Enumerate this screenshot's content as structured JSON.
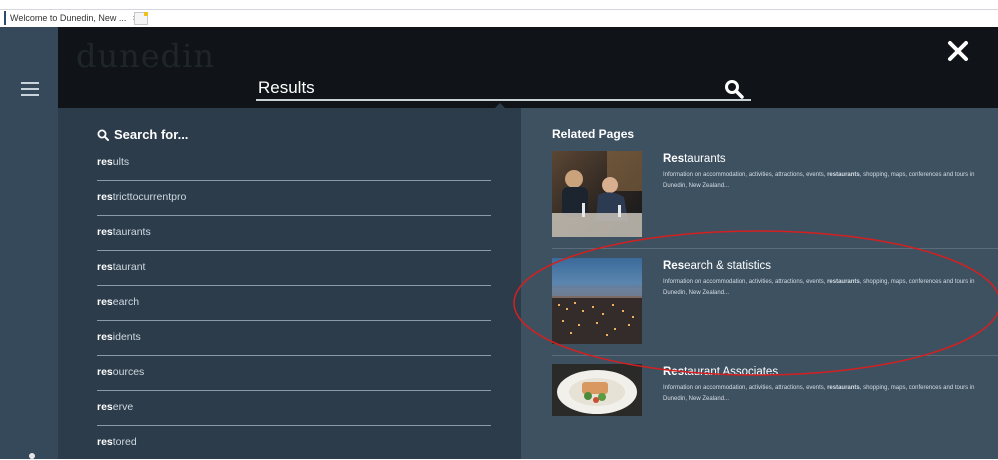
{
  "browser": {
    "tab_title": "Welcome to Dunedin, New ...",
    "tab_close": "×"
  },
  "header": {
    "logo": "dunedin",
    "search_value": "Results",
    "close_label": "✕"
  },
  "suggestions": {
    "heading": "Search for...",
    "items": [
      {
        "bold": "res",
        "rest": "ults"
      },
      {
        "bold": "res",
        "rest": "tricttocurrentpro"
      },
      {
        "bold": "res",
        "rest": "taurants"
      },
      {
        "bold": "res",
        "rest": "taurant"
      },
      {
        "bold": "res",
        "rest": "earch"
      },
      {
        "bold": "res",
        "rest": "idents"
      },
      {
        "bold": "res",
        "rest": "ources"
      },
      {
        "bold": "res",
        "rest": "erve"
      },
      {
        "bold": "res",
        "rest": "tored"
      }
    ]
  },
  "related": {
    "heading": "Related Pages",
    "items": [
      {
        "title_bold": "Res",
        "title_rest": "taurants",
        "desc_pre": "Information on accommodation, activities, attractions, events, ",
        "desc_bold": "restaurants",
        "desc_post": ", shopping, maps, conferences and tours in Dunedin, New Zealand..."
      },
      {
        "title_bold": "Res",
        "title_rest": "earch & statistics",
        "desc_pre": "Information on accommodation, activities, attractions, events, ",
        "desc_bold": "restaurants",
        "desc_post": ", shopping, maps, conferences and tours in Dunedin, New Zealand..."
      },
      {
        "title_bold": "Res",
        "title_rest": "taurant Associates",
        "desc_pre": "Information on accommodation, activities, attractions, events, ",
        "desc_bold": "restaurants",
        "desc_post": ", shopping, maps, conferences and tours in Dunedin, New Zealand..."
      }
    ]
  },
  "colors": {
    "header_bg": "#101418",
    "left_panel_bg": "#2c3c4b",
    "right_panel_bg": "#3e5161",
    "sidebar_bg": "#35495a",
    "highlight_ellipse": "#d42020"
  },
  "icons": {
    "menu": "hamburger-icon",
    "search": "search-icon",
    "close": "close-icon",
    "search_for": "magnifier-icon"
  }
}
